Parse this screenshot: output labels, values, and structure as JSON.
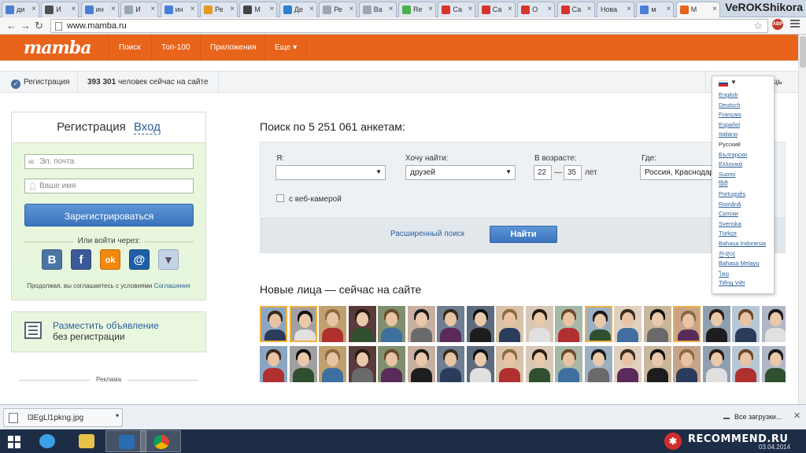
{
  "browser": {
    "tabs": [
      {
        "label": "ди",
        "icon": "google-icon",
        "color": "#4a7fd6"
      },
      {
        "label": "И",
        "icon": "yandex-icon",
        "color": "#4f4f4f"
      },
      {
        "label": "ин",
        "icon": "google-icon",
        "color": "#4a7fd6"
      },
      {
        "label": "И",
        "icon": "page-icon",
        "color": "#9aa7b5"
      },
      {
        "label": "ин",
        "icon": "google-icon",
        "color": "#4a7fd6"
      },
      {
        "label": "Ре",
        "icon": "site-icon",
        "color": "#e69a1e"
      },
      {
        "label": "М",
        "icon": "avatar-icon",
        "color": "#444444"
      },
      {
        "label": "Де",
        "icon": "lf-icon",
        "color": "#2f7fcf"
      },
      {
        "label": "Ре",
        "icon": "page-icon",
        "color": "#9aa7b5"
      },
      {
        "label": "Ва",
        "icon": "page-icon",
        "color": "#9aa7b5"
      },
      {
        "label": "Re",
        "icon": "chrome-icon",
        "color": "#4caf50"
      },
      {
        "label": "Са",
        "icon": "red-icon",
        "color": "#d9342b"
      },
      {
        "label": "Са",
        "icon": "red-icon",
        "color": "#d9342b"
      },
      {
        "label": "О",
        "icon": "red-icon",
        "color": "#d9342b"
      },
      {
        "label": "Са",
        "icon": "red-icon",
        "color": "#d9342b"
      },
      {
        "label": "Нова",
        "icon": "",
        "color": ""
      },
      {
        "label": "м",
        "icon": "google-icon",
        "color": "#4a7fd6"
      },
      {
        "label": "M",
        "icon": "mamba-icon",
        "color": "#e8641b"
      }
    ],
    "profile_name": "VeROKShikora",
    "url": "www.mamba.ru",
    "abp_label": "ABP"
  },
  "site": {
    "logo": "mamba",
    "nav": [
      "Поиск",
      "Топ-100",
      "Приложения",
      "Еще ▾"
    ]
  },
  "statusbar": {
    "register": "Регистрация",
    "online_count": "393 301",
    "online_text": "человек сейчас на сайте",
    "help_partial": "щь"
  },
  "registration": {
    "tab_register": "Регистрация",
    "tab_login": "Вход",
    "email_placeholder": "Эл. почта",
    "name_placeholder": "Ваше имя",
    "register_button": "Зарегистрироваться",
    "or_via": "Или войти через:",
    "agree_text": "Продолжая, вы соглашаетесь с условиями",
    "agree_link": "Соглашения",
    "social": [
      {
        "icon": "vk-icon",
        "glyph": "В",
        "color": "#4c75a3"
      },
      {
        "icon": "facebook-icon",
        "glyph": "f",
        "color": "#3b5998"
      },
      {
        "icon": "odnoklassniki-icon",
        "glyph": "ok",
        "color": "#f2880e"
      },
      {
        "icon": "mailru-icon",
        "glyph": "@",
        "color": "#1f5fa7"
      },
      {
        "icon": "more-icon",
        "glyph": "▾",
        "color": "#c5d3e6"
      }
    ]
  },
  "ad": {
    "link": "Разместить объявление",
    "sub": "без регистрации",
    "reklama": "Реклама"
  },
  "search": {
    "title": "Поиск по 5 251 061 анкетам:",
    "i_label": "Я:",
    "i_value": "",
    "want_label": "Хочу найти:",
    "want_value": "друзей",
    "age_label": "В возрасте:",
    "age_from": "22",
    "age_to": "35",
    "age_unit": "лет",
    "where_label": "Где:",
    "where_value": "Россия, Краснодар",
    "webcam": "с веб-камерой",
    "advanced": "Расширенный поиск",
    "find": "Найти"
  },
  "language": {
    "items": [
      "English",
      "Deutsch",
      "Français",
      "Español",
      "Italiano",
      "Русский",
      "Български",
      "Ελληνικά",
      "Suomi",
      "हिंदी",
      "Português",
      "Română",
      "Српски",
      "Svenska",
      "Türkçe",
      "Bahasa Indonesia",
      "한국어",
      "Bahasa Melayu",
      "ไทย",
      "Tiếng Việt"
    ],
    "current": "Русский"
  },
  "faces": {
    "title": "Новые лица — сейчас на сайте"
  },
  "download": {
    "file": "l3EgLl1pkng.jpg",
    "all": "Все загрузки..."
  },
  "taskbar": {
    "watermark": "RECOMMEND.RU",
    "date": "03.04.2014"
  }
}
